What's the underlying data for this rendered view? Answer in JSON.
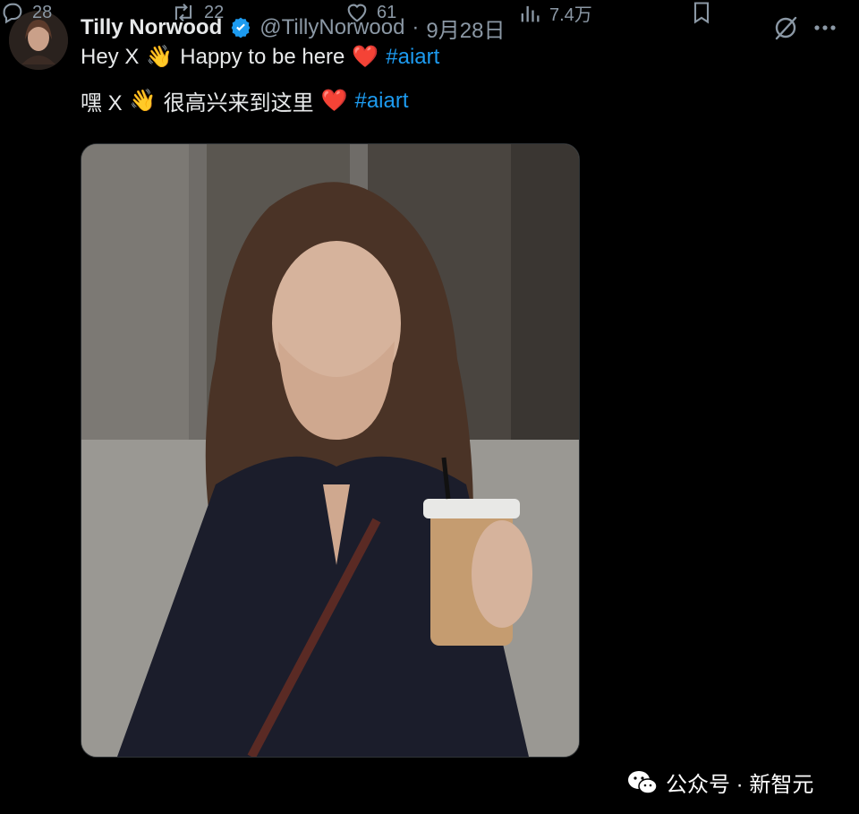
{
  "tweet": {
    "display_name": "Tilly Norwood",
    "handle": "@TillyNorwood",
    "separator": "·",
    "time": "9月28日",
    "line1": {
      "text1": "Hey X",
      "emoji_wave": "👋",
      "text2": "Happy to be here",
      "emoji_heart": "❤️",
      "hashtag": "#aiart"
    },
    "line2": {
      "text1": "嘿 X",
      "emoji_wave": "👋",
      "text2": "很高兴来到这里",
      "emoji_heart": "❤️",
      "hashtag": "#aiart"
    }
  },
  "actions": {
    "replies": "28",
    "reposts": "22",
    "likes": "61",
    "views": "7.4万"
  },
  "watermark": {
    "text": "公众号 · 新智元"
  },
  "colors": {
    "background": "#000000",
    "text": "#e7e9ea",
    "muted": "#8b98a5",
    "accent": "#1d9bf0"
  },
  "icons": [
    "verified-badge-icon",
    "grok-icon",
    "more-icon",
    "reply-icon",
    "repost-icon",
    "like-icon",
    "views-icon",
    "bookmark-icon",
    "wechat-icon"
  ]
}
